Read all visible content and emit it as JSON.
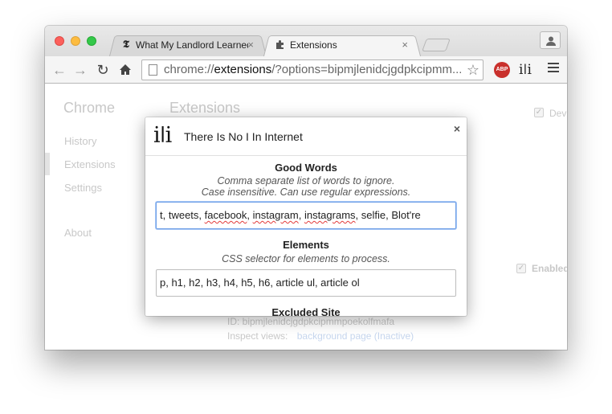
{
  "browser": {
    "tabs": [
      {
        "favicon": "nyt-icon",
        "title": "What My Landlord Learned",
        "close": "×"
      },
      {
        "favicon": "puzzle-icon",
        "title": "Extensions",
        "close": "×"
      }
    ],
    "omnibox": {
      "scheme": "chrome://",
      "host": "extensions",
      "rest": "/?options=bipmjlenidcjgdpkcipmm..."
    },
    "abp_label": "ABP",
    "ext_icon_text": "iǀi"
  },
  "background_page": {
    "sidebar_title": "Chrome",
    "sidebar_items": [
      "History",
      "Extensions",
      "Settings",
      "About"
    ],
    "page_title": "Extensions",
    "dev_mode_label": "Dev",
    "enabled_label": "Enabled",
    "extension_id": "ID: bipmjlenidcjgdpkcipmmpoekolfmafa",
    "inspect_label": "Inspect views:",
    "inspect_link": "background page (Inactive)"
  },
  "dialog": {
    "logo": "iǀi",
    "title": "There Is No I In Internet",
    "close": "×",
    "good_words": {
      "title": "Good Words",
      "desc_line1": "Comma separate list of words to ignore.",
      "desc_line2": "Case insensitive. Can use regular expressions.",
      "value_parts": [
        "t, tweets, ",
        "facebook",
        ", ",
        "instagram",
        ", ",
        "instagrams",
        ", selfie, Blot're"
      ]
    },
    "elements": {
      "title": "Elements",
      "desc": "CSS selector for elements to process.",
      "value": "p, h1, h2, h3, h4, h5, h6, article ul, article ol"
    },
    "excluded": {
      "title": "Excluded Site"
    }
  },
  "colors": {
    "focus_border": "#6f9fe6",
    "abp_red": "#c9302c",
    "close_red": "#fc605c",
    "minimize_yellow": "#fdbc40",
    "zoom_green": "#34c84a"
  }
}
